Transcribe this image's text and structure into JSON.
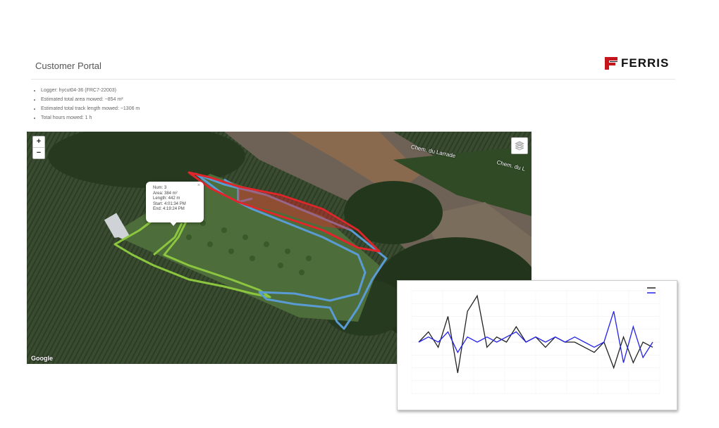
{
  "header": {
    "title": "Customer Portal",
    "logo_text": "FERRIS"
  },
  "stats": [
    "Logger: hycut04-36 (FRC7-22003)",
    "Estimated total area mowed: ~854 m²",
    "Estimated total track length mowed: ~1306 m",
    "Total hours mowed: 1 h"
  ],
  "map": {
    "zoom_in": "+",
    "zoom_out": "−",
    "attribution": "Google",
    "road_labels": [
      "Chem. du Larrade",
      "Chem. du L"
    ],
    "popup": {
      "close": "×",
      "lines": [
        "Num: 3",
        "Area: 384 m²",
        "Length: 442 m",
        "Start: 4:01:34 PM",
        "End: 4:19:24 PM"
      ]
    },
    "track_colors": {
      "green": "#8cc63f",
      "blue": "#5a9bd4",
      "red": "#e0262b"
    }
  },
  "chart_data": {
    "type": "line",
    "legend_placement": "top-right",
    "grid": true,
    "series": [
      {
        "color": "#222222",
        "values": [
          0,
          2,
          -1,
          5,
          -6,
          6,
          9,
          -1,
          1,
          0,
          3,
          0,
          1,
          -1,
          1,
          0,
          0,
          -1,
          -2,
          0,
          -5,
          1,
          -4,
          0,
          -1
        ]
      },
      {
        "color": "#2222ee",
        "values": [
          0,
          1,
          0,
          2,
          -2,
          1,
          0,
          1,
          0,
          1,
          2,
          0,
          1,
          0,
          1,
          0,
          1,
          0,
          -1,
          0,
          6,
          -4,
          3,
          -3,
          0
        ]
      }
    ]
  }
}
